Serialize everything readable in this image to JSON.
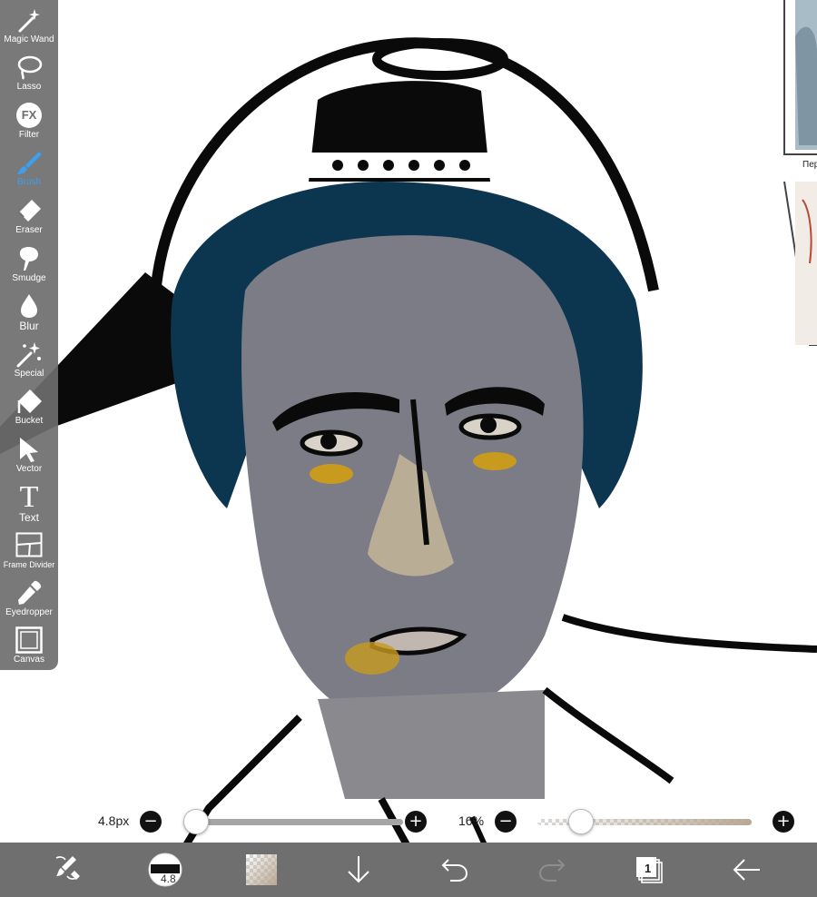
{
  "toolbar": {
    "tools": [
      {
        "id": "magic-wand",
        "label": "Magic Wand",
        "icon": "magic-wand-icon"
      },
      {
        "id": "lasso",
        "label": "Lasso",
        "icon": "lasso-icon"
      },
      {
        "id": "filter",
        "label": "Filter",
        "icon": "fx-icon",
        "icon_text": "FX"
      },
      {
        "id": "brush",
        "label": "Brush",
        "icon": "brush-icon",
        "active": true
      },
      {
        "id": "eraser",
        "label": "Eraser",
        "icon": "eraser-icon"
      },
      {
        "id": "smudge",
        "label": "Smudge",
        "icon": "smudge-icon"
      },
      {
        "id": "blur",
        "label": "Blur",
        "icon": "blur-drop-icon"
      },
      {
        "id": "special",
        "label": "Special",
        "icon": "special-sparkle-icon"
      },
      {
        "id": "bucket",
        "label": "Bucket",
        "icon": "bucket-icon"
      },
      {
        "id": "vector",
        "label": "Vector",
        "icon": "vector-arrow-icon"
      },
      {
        "id": "text",
        "label": "Text",
        "icon": "text-icon",
        "icon_text": "T"
      },
      {
        "id": "frame-divider",
        "label": "Frame Divider",
        "icon": "frame-divider-icon"
      },
      {
        "id": "eyedropper",
        "label": "Eyedropper",
        "icon": "eyedropper-icon"
      },
      {
        "id": "canvas",
        "label": "Canvas",
        "icon": "canvas-icon"
      }
    ],
    "active_color": "#3aa0f0"
  },
  "sliders": {
    "brush_size": {
      "value_label": "4.8px",
      "minus": "−",
      "plus": "+",
      "level": 0.0
    },
    "opacity": {
      "value_label": "16%",
      "minus": "−",
      "plus": "+",
      "level": 0.16
    }
  },
  "bottom_bar": {
    "brush_size_badge": "4.8",
    "layers_count": "1",
    "background_color": "#6f6f6f"
  },
  "ref_panel": {
    "caption": "Пер"
  }
}
